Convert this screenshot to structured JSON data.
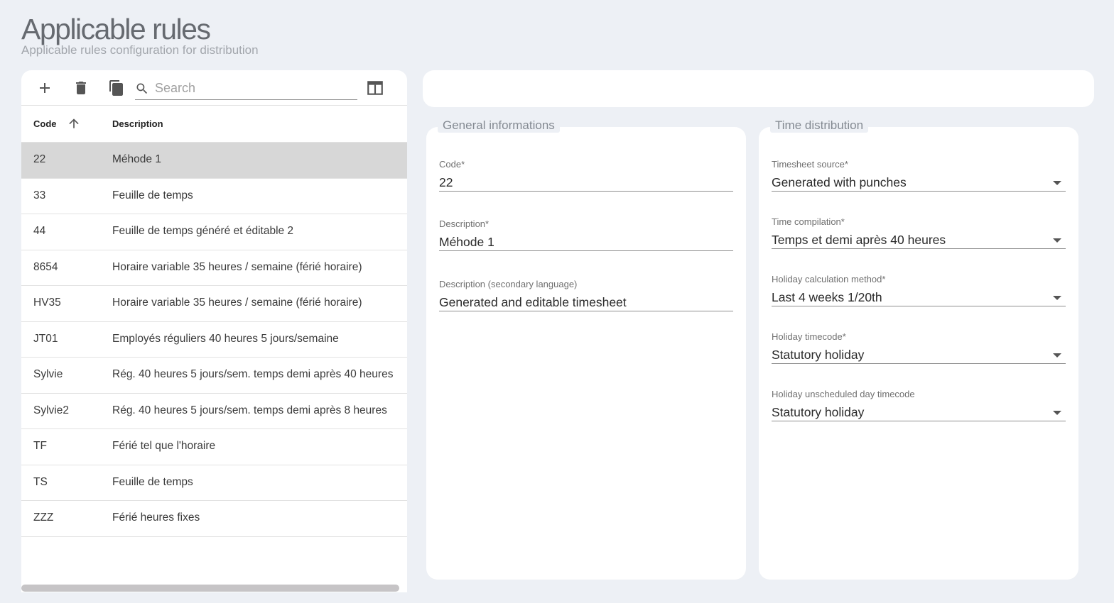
{
  "page": {
    "title": "Applicable rules",
    "subtitle": "Applicable rules configuration for distribution"
  },
  "toolbar": {
    "add_icon": "plus-icon",
    "delete_icon": "trash-icon",
    "copy_icon": "copy-icon",
    "search_icon": "search-icon",
    "search_placeholder": "Search",
    "search_value": "",
    "columns_icon": "columns-icon"
  },
  "table": {
    "headers": {
      "code": "Code",
      "description": "Description"
    },
    "sort": {
      "column": "code",
      "direction": "asc",
      "icon": "arrow-up-icon"
    },
    "rows": [
      {
        "code": "22",
        "description": "Méhode 1",
        "selected": true
      },
      {
        "code": "33",
        "description": "Feuille de temps"
      },
      {
        "code": "44",
        "description": "Feuille de temps généré et éditable 2"
      },
      {
        "code": "8654",
        "description": "Horaire variable 35 heures / semaine (férié horaire)"
      },
      {
        "code": "HV35",
        "description": "Horaire variable 35 heures / semaine (férié horaire)"
      },
      {
        "code": "JT01",
        "description": "Employés réguliers 40 heures 5 jours/semaine"
      },
      {
        "code": "Sylvie",
        "description": "Rég. 40 heures 5 jours/sem. temps demi après 40 heures"
      },
      {
        "code": "Sylvie2",
        "description": "Rég. 40 heures 5 jours/sem. temps demi après 8 heures"
      },
      {
        "code": "TF",
        "description": "Férié tel que l'horaire"
      },
      {
        "code": "TS",
        "description": "Feuille de temps"
      },
      {
        "code": "ZZZ",
        "description": "Férié heures fixes"
      }
    ]
  },
  "general": {
    "legend": "General informations",
    "code": {
      "label": "Code",
      "required": "*",
      "value": "22"
    },
    "description": {
      "label": "Description",
      "required": "*",
      "value": "Méhode 1"
    },
    "description_secondary": {
      "label": "Description (secondary language)",
      "value": "Generated and editable timesheet"
    }
  },
  "time_distribution": {
    "legend": "Time distribution",
    "timesheet_source": {
      "label": "Timesheet source",
      "required": "*",
      "value": "Generated with punches"
    },
    "time_compilation": {
      "label": "Time compilation",
      "required": "*",
      "value": "Temps et demi après 40 heures"
    },
    "holiday_calc": {
      "label": "Holiday calculation method",
      "required": "*",
      "value": "Last 4 weeks 1/20th"
    },
    "holiday_timecode": {
      "label": "Holiday timecode",
      "required": "*",
      "value": "Statutory holiday"
    },
    "holiday_unscheduled": {
      "label": "Holiday unscheduled day timecode",
      "value": "Statutory holiday"
    }
  },
  "colors": {
    "background": "#edf0f5",
    "selected_row": "#d7d7d7",
    "scrollbar": "#c6c4c6"
  }
}
